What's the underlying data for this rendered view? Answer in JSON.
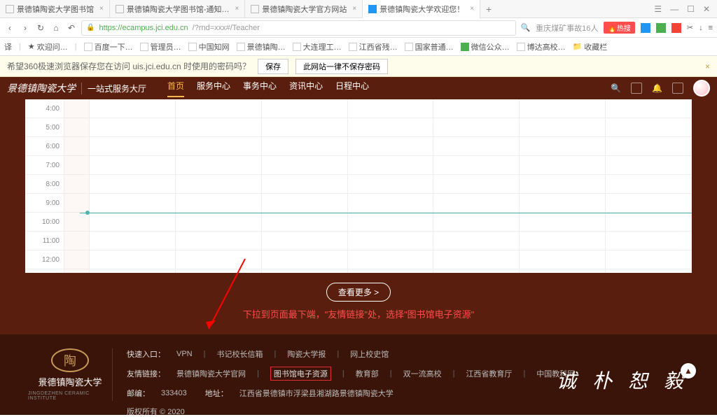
{
  "tabs": [
    {
      "title": "景德镇陶瓷大学图书馆"
    },
    {
      "title": "景德镇陶瓷大学图书馆-通知…"
    },
    {
      "title": "景德镇陶瓷大学官方网站"
    },
    {
      "title": "景德镇陶瓷大学欢迎您！"
    }
  ],
  "url": {
    "host": "https://ecampus.jci.edu.cn",
    "path": "/?rnd=xxx#/Teacher"
  },
  "search_hint": "重庆煤矿事故16人",
  "hot_label": "热搜",
  "bookmarks": {
    "prefix": "译",
    "fav_label": "欢迎问…",
    "items": [
      "百度一下…",
      "管理员…",
      "中国知网",
      "景德镇陶…",
      "大连理工…",
      "江西省残…",
      "国家普通…",
      "微信公众…",
      "博达高校…",
      "收藏栏"
    ]
  },
  "pwbar": {
    "msg": "希望360极速浏览器保存您在访问 uis.jci.edu.cn 时使用的密码吗？",
    "save": "保存",
    "never": "此网站一律不保存密码"
  },
  "topnav": {
    "logo": "景德镇陶瓷大学",
    "sub": "一站式服务大厅",
    "menu": [
      "首页",
      "服务中心",
      "事务中心",
      "资讯中心",
      "日程中心"
    ]
  },
  "times": [
    "4:00",
    "5:00",
    "6:00",
    "7:00",
    "8:00",
    "9:00",
    "10:00",
    "11:00",
    "12:00"
  ],
  "more_btn": "查看更多 >",
  "hint": "下拉到页面最下端，\"友情链接\"处，选择\"图书馆电子资源\"",
  "footer": {
    "quick_label": "快速入口：",
    "quick": [
      "VPN",
      "书记校长信箱",
      "陶瓷大学报",
      "网上校史馆"
    ],
    "links_label": "友情链接：",
    "links": [
      "景德镇陶瓷大学官网",
      "图书馆电子资源",
      "教育部",
      "双一流高校",
      "江西省教育厅",
      "中国教科网"
    ],
    "post_label": "邮编：",
    "post": "333403",
    "addr_label": "地址：",
    "addr": "江西省景德镇市浮梁县湘湖路景德镇陶瓷大学",
    "copy": "版权所有 © 2020",
    "logo_name": "景德镇陶瓷大学",
    "logo_en": "JINGDEZHEN CERAMIC INSTITUTE",
    "motto": "诚 朴 恕 毅"
  }
}
